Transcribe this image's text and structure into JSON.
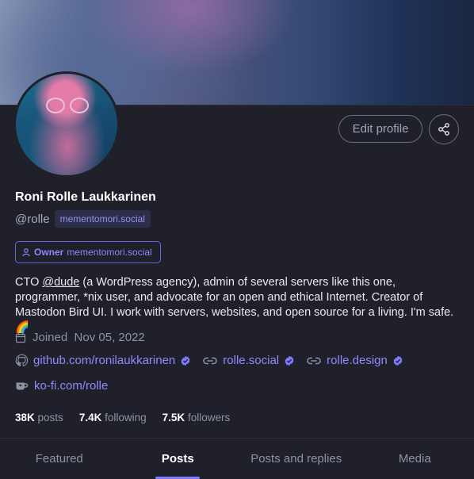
{
  "profile": {
    "display_name": "Roni Rolle Laukkarinen",
    "handle": "@rolle",
    "domain": "mementomori.social",
    "role": {
      "label": "Owner",
      "server": "mementomori.social"
    },
    "bio_prefix": "CTO ",
    "bio_mention": "@dude",
    "bio_suffix": " (a WordPress agency), admin of several servers like this one, programmer, *nix user, and advocate for an open and ethical Internet. Creator of Mastodon Bird UI. I work with servers, websites, and open source for a living. I'm safe. 🌈",
    "joined": "Joined  Nov 05, 2022",
    "links": [
      {
        "text": "github.com/ronilaukkarinen",
        "icon": "github-icon",
        "verified": true
      },
      {
        "text": "rolle.social",
        "icon": "link-icon",
        "verified": true
      },
      {
        "text": "rolle.design",
        "icon": "link-icon",
        "verified": true
      }
    ],
    "kofi": "ko-fi.com/rolle",
    "stats": {
      "posts_count": "38K",
      "posts_label": "posts",
      "following_count": "7.4K",
      "following_label": "following",
      "followers_count": "7.5K",
      "followers_label": "followers"
    }
  },
  "actions": {
    "edit_label": "Edit profile"
  },
  "tabs": [
    {
      "label": "Featured",
      "active": false
    },
    {
      "label": "Posts",
      "active": true
    },
    {
      "label": "Posts and replies",
      "active": false
    },
    {
      "label": "Media",
      "active": false
    }
  ],
  "colors": {
    "accent": "#7f7bff",
    "background": "#1f2029"
  }
}
